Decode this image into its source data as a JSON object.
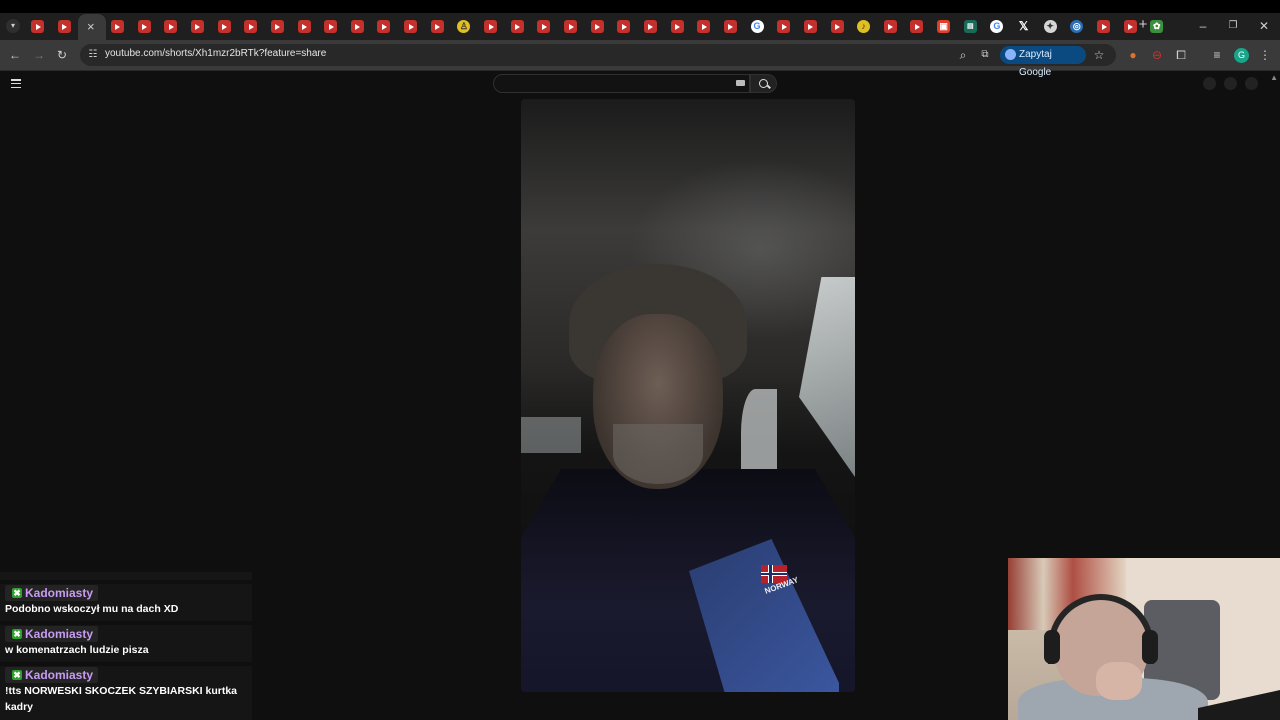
{
  "browser": {
    "url": "youtube.com/shorts/Xh1mzr2bRTk?feature=share",
    "ask_google_label": "Zapytaj Google",
    "profile_initial": "G",
    "new_tab_symbol": "+",
    "tab_close_symbol": "×",
    "window_controls": {
      "minimize": "–",
      "restore": "❐",
      "close": "✕"
    },
    "tabs_favicons": [
      "youtube-icon",
      "youtube-icon",
      "active-tab-close",
      "youtube-icon",
      "youtube-icon",
      "youtube-icon",
      "youtube-icon",
      "youtube-icon",
      "youtube-icon",
      "youtube-icon",
      "youtube-icon",
      "youtube-icon",
      "youtube-icon",
      "youtube-icon",
      "youtube-icon",
      "youtube-icon",
      "award-icon",
      "youtube-icon",
      "youtube-icon",
      "youtube-icon",
      "youtube-icon",
      "youtube-icon",
      "youtube-icon",
      "youtube-icon",
      "youtube-icon",
      "youtube-icon",
      "youtube-icon",
      "google-icon",
      "youtube-icon",
      "youtube-icon",
      "youtube-icon",
      "bell-icon",
      "youtube-icon",
      "youtube-icon",
      "red-app-icon",
      "teal-app-icon",
      "google-icon",
      "x-icon",
      "gray-app-icon",
      "steam-icon",
      "youtube-icon",
      "youtube-icon",
      "leaf-icon"
    ]
  },
  "youtube": {
    "search_placeholder": ""
  },
  "video": {
    "jacket_text": "NORWAY"
  },
  "chat": {
    "messages": [
      {
        "user": "Kadomiasty",
        "text": "Podobno wskoczył mu na dach XD"
      },
      {
        "user": "Kadomiasty",
        "text": "w komenatrzach ludzie pisza"
      },
      {
        "user": "Kadomiasty",
        "text": "!tts NORWESKI SKOCZEK SZYBIARSKI kurtka kadry"
      }
    ],
    "badge_symbol": "✖"
  },
  "colors": {
    "youtube_red": "#c4302b",
    "chat_username": "#c79cf2",
    "chat_badge": "#2da02d",
    "ask_google_bg": "#0b4a80"
  }
}
